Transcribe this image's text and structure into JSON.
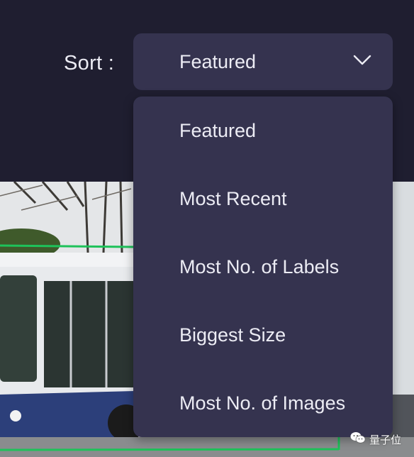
{
  "sort": {
    "label": "Sort :",
    "selected": "Featured",
    "chevron_icon": "chevron-down-icon"
  },
  "menu": {
    "items": [
      {
        "label": "Featured"
      },
      {
        "label": "Most Recent"
      },
      {
        "label": "Most No. of Labels"
      },
      {
        "label": "Biggest Size"
      },
      {
        "label": "Most No. of Images"
      }
    ]
  },
  "watermark": {
    "text": "量子位",
    "icon": "wechat-icon"
  },
  "colors": {
    "page_bg": "#1f1e30",
    "panel_bg": "#35334f",
    "text": "#ececf4",
    "bbox_green": "#1ec25a"
  }
}
